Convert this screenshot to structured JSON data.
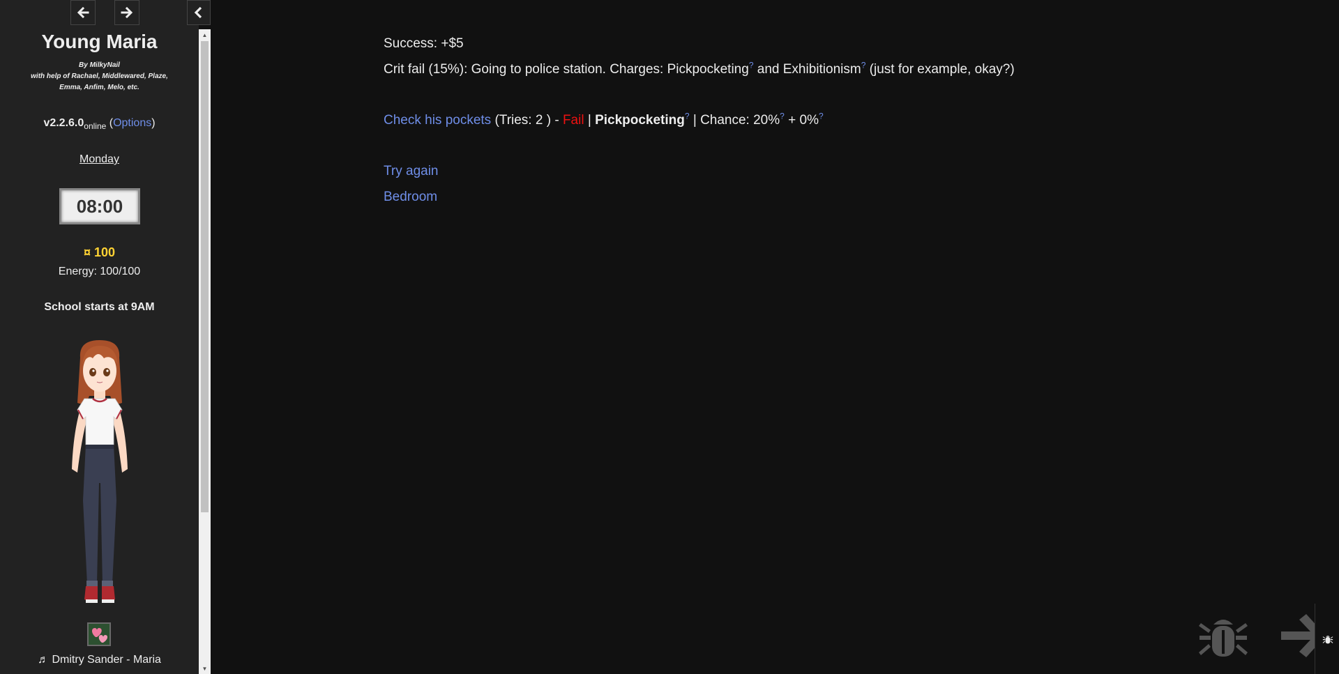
{
  "sidebar": {
    "title": "Young Maria",
    "byline_1": "By MilkyNail",
    "byline_2": "with help of Rachael, Middlewared, Plaze,",
    "byline_3": "Emma, Anfim, Melo, etc.",
    "version": "v2.2.6.0",
    "version_suffix": "online",
    "options_open": "(",
    "options_label": "Options",
    "options_close": ")",
    "day": "Monday",
    "time": "08:00",
    "money": "¤ 100",
    "energy": "Energy: 100/100",
    "notice": "School starts at 9AM",
    "music": "♬ Dmitry Sander - Maria"
  },
  "main": {
    "success_line": "Success: +$5",
    "crit_prefix": "Crit fail (15%): Going to police station. Charges: Pickpocketing",
    "crit_and": " and Exhibitionism",
    "crit_suffix": " (just for example, okay?)",
    "help_mark": "?",
    "check_link": "Check his pockets",
    "tries": " (Tries: 2 ) - ",
    "fail": "Fail",
    "sep1": " | ",
    "skill": "Pickpocketing",
    "chance": " | Chance: 20%",
    "plus": " + 0%",
    "try_again": "Try again",
    "bedroom": "Bedroom"
  },
  "colors": {
    "background": "#111111",
    "sidebar": "#222222",
    "link": "#6f8ee8",
    "fail": "#ee1111",
    "money": "#ffd333"
  },
  "icons": {
    "history_back": "arrow-left-icon",
    "history_forward": "arrow-right-icon",
    "sidebar_toggle": "chevron-left-icon",
    "debug": "bug-icon",
    "next": "arrow-right-icon"
  }
}
